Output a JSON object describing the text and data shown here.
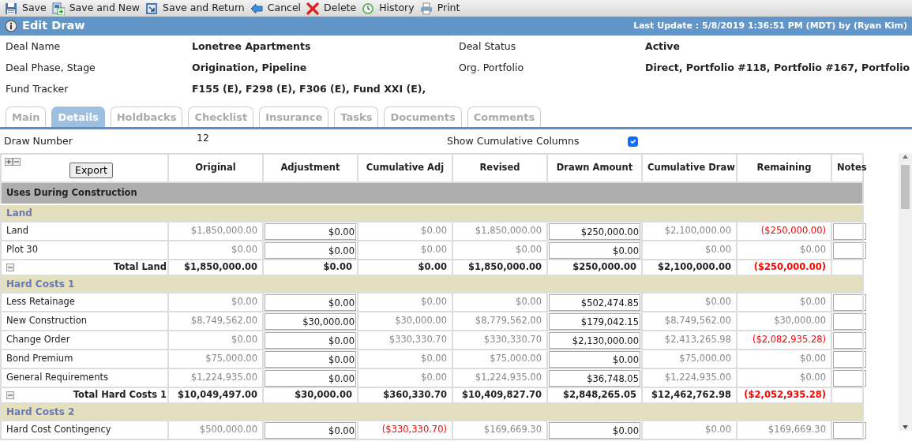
{
  "toolbar": [
    {
      "label": "Save",
      "kind": "save"
    },
    {
      "label": "Save and New",
      "kind": "new"
    },
    {
      "label": "Save and Return",
      "kind": "return"
    },
    {
      "label": "Cancel",
      "kind": "cancel"
    },
    {
      "label": "Delete",
      "kind": "delete"
    },
    {
      "label": "History",
      "kind": "history"
    },
    {
      "label": "Print",
      "kind": "print"
    }
  ],
  "header": {
    "title": "Edit Draw",
    "last_update": "Last Update : 5/8/2019 1:36:51 PM (MDT) by (Ryan Kim)"
  },
  "fields": [
    {
      "label": "Deal Name",
      "value": "Lonetree Apartments"
    },
    {
      "label": "Deal Status",
      "value": "Active"
    },
    {
      "label": "Deal Phase, Stage",
      "value": "Origination, Pipeline"
    },
    {
      "label": "Org. Portfolio",
      "value": "Direct, Portfolio #118, Portfolio #167, Portfolio"
    },
    {
      "label": "Fund Tracker",
      "value": "F155 (E), F298 (E), F306 (E), Fund XXI (E),"
    }
  ],
  "tabs": [
    {
      "label": "Main",
      "selected": false
    },
    {
      "label": "Details",
      "selected": true
    },
    {
      "label": "Holdbacks",
      "selected": false
    },
    {
      "label": "Checklist",
      "selected": false
    },
    {
      "label": "Insurance",
      "selected": false
    },
    {
      "label": "Tasks",
      "selected": false
    },
    {
      "label": "Documents",
      "selected": false
    },
    {
      "label": "Comments",
      "selected": false
    }
  ],
  "draw_number": {
    "label": "Draw Number",
    "value": "12"
  },
  "show_cumulative": {
    "label": "Show Cumulative Columns",
    "checked": true
  },
  "table": {
    "export_label": "Export",
    "columns": [
      {
        "label": "Original",
        "editable": false
      },
      {
        "label": "Adjustment",
        "editable": true
      },
      {
        "label": "Cumulative Adj",
        "editable": false
      },
      {
        "label": "Revised",
        "editable": false
      },
      {
        "label": "Drawn Amount",
        "editable": true
      },
      {
        "label": "Cumulative Draw",
        "editable": false
      },
      {
        "label": "Remaining",
        "editable": false
      },
      {
        "label": "Notes",
        "editable": true
      }
    ],
    "rows": [
      {
        "kind": "section",
        "label": "Uses During Construction"
      },
      {
        "kind": "group",
        "label": "Land"
      },
      {
        "kind": "item",
        "label": "Land",
        "cells": [
          {
            "text": "$1,850,000.00",
            "negative": false
          },
          {
            "text": "$0.00",
            "negative": false
          },
          {
            "text": "$0.00",
            "negative": false
          },
          {
            "text": "$1,850,000.00",
            "negative": false
          },
          {
            "text": "$250,000.00",
            "negative": false
          },
          {
            "text": "$2,100,000.00",
            "negative": false
          },
          {
            "text": "($250,000.00)",
            "negative": true
          }
        ]
      },
      {
        "kind": "item",
        "label": "Plot 30",
        "cells": [
          {
            "text": "$0.00",
            "negative": false
          },
          {
            "text": "$0.00",
            "negative": false
          },
          {
            "text": "$0.00",
            "negative": false
          },
          {
            "text": "$0.00",
            "negative": false
          },
          {
            "text": "$0.00",
            "negative": false
          },
          {
            "text": "$0.00",
            "negative": false
          },
          {
            "text": "$0.00",
            "negative": false
          }
        ]
      },
      {
        "kind": "total",
        "label": "Total Land",
        "cells": [
          {
            "text": "$1,850,000.00",
            "negative": false
          },
          {
            "text": "$0.00",
            "negative": false
          },
          {
            "text": "$0.00",
            "negative": false
          },
          {
            "text": "$1,850,000.00",
            "negative": false
          },
          {
            "text": "$250,000.00",
            "negative": false
          },
          {
            "text": "$2,100,000.00",
            "negative": false
          },
          {
            "text": "($250,000.00)",
            "negative": true
          }
        ]
      },
      {
        "kind": "group",
        "label": "Hard Costs 1"
      },
      {
        "kind": "item",
        "label": "Less Retainage",
        "cells": [
          {
            "text": "$0.00",
            "negative": false
          },
          {
            "text": "$0.00",
            "negative": false
          },
          {
            "text": "$0.00",
            "negative": false
          },
          {
            "text": "$0.00",
            "negative": false
          },
          {
            "text": "$502,474.85",
            "negative": false
          },
          {
            "text": "$0.00",
            "negative": false
          },
          {
            "text": "$0.00",
            "negative": false
          }
        ]
      },
      {
        "kind": "item",
        "label": "New Construction",
        "cells": [
          {
            "text": "$8,749,562.00",
            "negative": false
          },
          {
            "text": "$30,000.00",
            "negative": false
          },
          {
            "text": "$30,000.00",
            "negative": false
          },
          {
            "text": "$8,779,562.00",
            "negative": false
          },
          {
            "text": "$179,042.15",
            "negative": false
          },
          {
            "text": "$8,749,562.00",
            "negative": false
          },
          {
            "text": "$30,000.00",
            "negative": false
          }
        ]
      },
      {
        "kind": "item",
        "label": "Change Order",
        "cells": [
          {
            "text": "$0.00",
            "negative": false
          },
          {
            "text": "$0.00",
            "negative": false
          },
          {
            "text": "$330,330.70",
            "negative": false
          },
          {
            "text": "$330,330.70",
            "negative": false
          },
          {
            "text": "$2,130,000.00",
            "negative": false
          },
          {
            "text": "$2,413,265.98",
            "negative": false
          },
          {
            "text": "($2,082,935.28)",
            "negative": true
          }
        ]
      },
      {
        "kind": "item",
        "label": "Bond Premium",
        "cells": [
          {
            "text": "$75,000.00",
            "negative": false
          },
          {
            "text": "$0.00",
            "negative": false
          },
          {
            "text": "$0.00",
            "negative": false
          },
          {
            "text": "$75,000.00",
            "negative": false
          },
          {
            "text": "$0.00",
            "negative": false
          },
          {
            "text": "$75,000.00",
            "negative": false
          },
          {
            "text": "$0.00",
            "negative": false
          }
        ]
      },
      {
        "kind": "item",
        "label": "General Requirements",
        "cells": [
          {
            "text": "$1,224,935.00",
            "negative": false
          },
          {
            "text": "$0.00",
            "negative": false
          },
          {
            "text": "$0.00",
            "negative": false
          },
          {
            "text": "$1,224,935.00",
            "negative": false
          },
          {
            "text": "$36,748.05",
            "negative": false
          },
          {
            "text": "$1,224,935.00",
            "negative": false
          },
          {
            "text": "$0.00",
            "negative": false
          }
        ]
      },
      {
        "kind": "total",
        "label": "Total Hard Costs 1",
        "cells": [
          {
            "text": "$10,049,497.00",
            "negative": false
          },
          {
            "text": "$30,000.00",
            "negative": false
          },
          {
            "text": "$360,330.70",
            "negative": false
          },
          {
            "text": "$10,409,827.70",
            "negative": false
          },
          {
            "text": "$2,848,265.05",
            "negative": false
          },
          {
            "text": "$12,462,762.98",
            "negative": false
          },
          {
            "text": "($2,052,935.28)",
            "negative": true
          }
        ]
      },
      {
        "kind": "group",
        "label": "Hard Costs 2"
      },
      {
        "kind": "item",
        "label": "Hard Cost Contingency",
        "cells": [
          {
            "text": "$500,000.00",
            "negative": false
          },
          {
            "text": "$0.00",
            "negative": false
          },
          {
            "text": "($330,330.70)",
            "negative": true
          },
          {
            "text": "$169,669.30",
            "negative": false
          },
          {
            "text": "$0.00",
            "negative": false
          },
          {
            "text": "$0.00",
            "negative": false
          },
          {
            "text": "$169,669.30",
            "negative": false
          }
        ]
      }
    ]
  }
}
